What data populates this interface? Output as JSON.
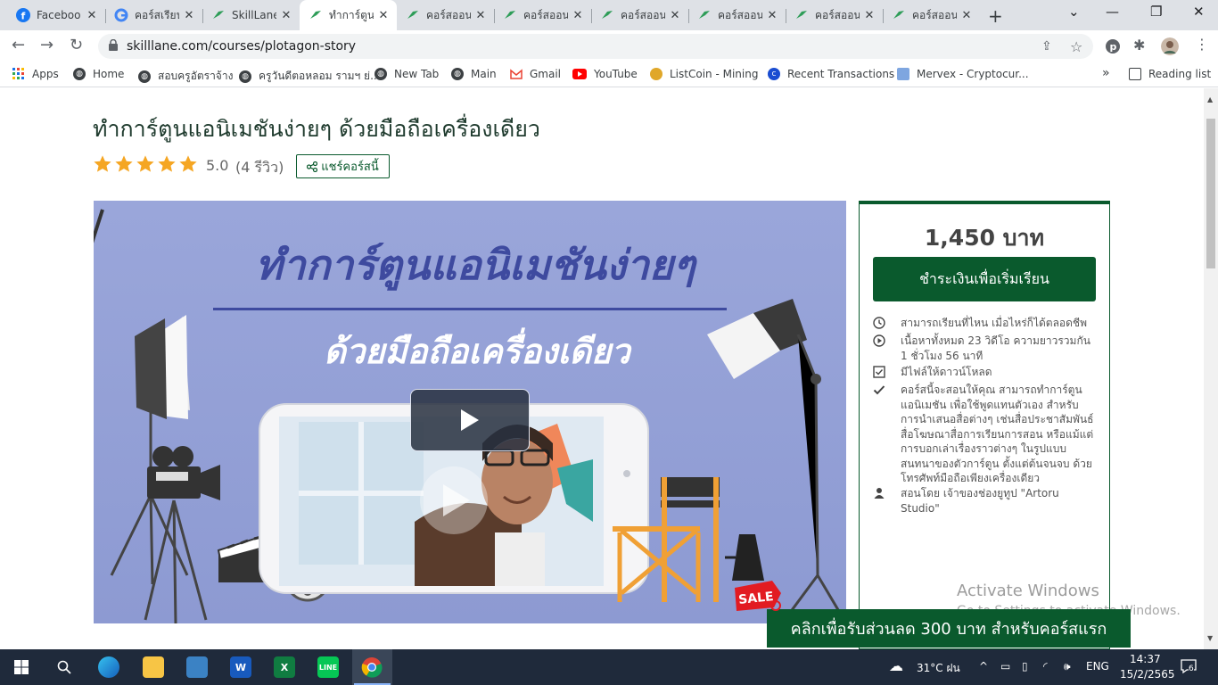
{
  "browser": {
    "tabs": [
      {
        "title": "Faceboo",
        "icon": "facebook-icon"
      },
      {
        "title": "คอร์สเรียน",
        "icon": "google-icon"
      },
      {
        "title": "SkillLane",
        "icon": "skilllane-icon"
      },
      {
        "title": "ทำการ์ตูน",
        "icon": "skilllane-icon",
        "active": true
      },
      {
        "title": "คอร์สออน",
        "icon": "skilllane-icon"
      },
      {
        "title": "คอร์สออน",
        "icon": "skilllane-icon"
      },
      {
        "title": "คอร์สออน",
        "icon": "skilllane-icon"
      },
      {
        "title": "คอร์สออน",
        "icon": "skilllane-icon"
      },
      {
        "title": "คอร์สออน",
        "icon": "skilllane-icon"
      },
      {
        "title": "คอร์สออน",
        "icon": "skilllane-icon"
      }
    ],
    "url": "skilllane.com/courses/plotagon-story",
    "bookmarks": [
      {
        "label": "Apps",
        "icon": "apps-grid-icon"
      },
      {
        "label": "Home",
        "icon": "globe-icon"
      },
      {
        "label": "สอบครูอัตราจ้าง",
        "icon": "globe-icon"
      },
      {
        "label": "ครูวันดีตอหลอม รามฯ ย่...",
        "icon": "globe-icon"
      },
      {
        "label": "New Tab",
        "icon": "globe-icon"
      },
      {
        "label": "Main",
        "icon": "globe-icon"
      },
      {
        "label": "Gmail",
        "icon": "gmail-icon"
      },
      {
        "label": "YouTube",
        "icon": "youtube-icon"
      },
      {
        "label": "ListCoin - Mining",
        "icon": "listcoin-icon"
      },
      {
        "label": "Recent Transactions",
        "icon": "transactions-icon"
      },
      {
        "label": "Mervex - Cryptocur...",
        "icon": "mervex-icon"
      }
    ],
    "more_bookmarks": "»",
    "reading_list": "Reading list"
  },
  "course": {
    "title": "ทำการ์ตูนแอนิเมชันง่ายๆ ด้วยมือถือเครื่องเดียว",
    "rating": "5.0",
    "stars": 5,
    "reviews": "(4 รีวิว)",
    "share_label": "แชร์คอร์สนี้",
    "hero_line1": "ทำการ์ตูนแอนิเมชันง่ายๆ",
    "hero_line2": "ด้วยมือถือเครื่องเดียว",
    "sale_tag": "SALE"
  },
  "buybox": {
    "price": "1,450 บาท",
    "buy_label": "ชำระเงินเพื่อเริ่มเรียน",
    "features": [
      {
        "icon": "clock-icon",
        "text": "สามารถเรียนที่ไหน เมื่อไหร่ก็ได้ตลอดชีพ"
      },
      {
        "icon": "play-circle-icon",
        "text": "เนื้อหาทั้งหมด 23 วิดีโอ ความยาวรวมกัน 1 ชั่วโมง 56 นาที"
      },
      {
        "icon": "checkbox-icon",
        "text": "มีไฟล์ให้ดาวน์โหลด"
      },
      {
        "icon": "check-icon",
        "text": "คอร์สนี้จะสอนให้คุณ สามารถทำการ์ตูนแอนิเมชัน เพื่อใช้พูดแทนตัวเอง สำหรับการนำเสนอสื่อต่างๆ เช่นสื่อประชาสัมพันธ์ สื่อโฆษณาสื่อการเรียนการสอน หรือแม้แต่การบอกเล่าเรื่องราวต่างๆ ในรูปแบบสนทนาของตัวการ์ตูน ตั้งแต่ต้นจนจบ ด้วยโทรศัพท์มือถือเพียงเครื่องเดียว"
      },
      {
        "icon": "user-icon",
        "text": "สอนโดย เจ้าของช่องยูทูป \"Artoru Studio\""
      }
    ]
  },
  "promo": {
    "label": "คลิกเพื่อรับส่วนลด 300 บาท สำหรับคอร์สแรก"
  },
  "watermark": {
    "line1": "Activate Windows",
    "line2": "Go to Settings to activate Windows."
  },
  "taskbar": {
    "weather": "31°C ฝน",
    "language": "ENG",
    "time": "14:37",
    "date": "15/2/2565",
    "notifications": "6"
  },
  "colors": {
    "brand": "#0a5a2d",
    "star": "#f5a623"
  }
}
